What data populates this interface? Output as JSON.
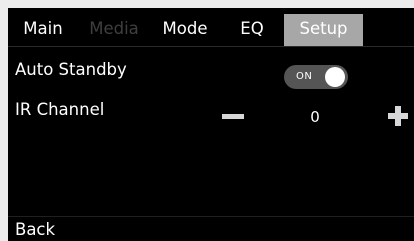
{
  "tabs": [
    {
      "label": "Main",
      "state": "normal"
    },
    {
      "label": "Media",
      "state": "disabled"
    },
    {
      "label": "Mode",
      "state": "normal"
    },
    {
      "label": "EQ",
      "state": "normal"
    },
    {
      "label": "Setup",
      "state": "active"
    }
  ],
  "settings": {
    "auto_standby": {
      "label": "Auto Standby",
      "toggle_text": "ON",
      "enabled": true
    },
    "ir_channel": {
      "label": "IR Channel",
      "value": "0",
      "minus_icon": "minus-icon",
      "plus_icon": "plus-icon"
    }
  },
  "footer": {
    "back_label": "Back"
  },
  "colors": {
    "background": "#000000",
    "active_tab": "#a7a7a7",
    "disabled_text": "#3f3f3f",
    "toggle_track": "#555555"
  }
}
